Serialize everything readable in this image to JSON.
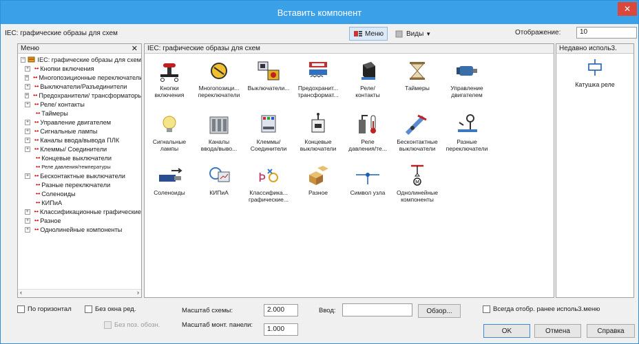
{
  "window": {
    "title": "Вставить компонент",
    "close": "✕"
  },
  "toolbar": {
    "library_label": "IEC: графические образы для схем",
    "menu_button": "Меню",
    "views_button": "Виды",
    "display_label": "Отображение:",
    "display_value": "10"
  },
  "menu_panel": {
    "title": "Меню",
    "close": "✕",
    "root": "IEC: графические образы для схем",
    "items": [
      {
        "label": "Кнопки включения",
        "expandable": true
      },
      {
        "label": "Многопозиционные переключатели",
        "expandable": true
      },
      {
        "label": "Выключатели/Разъединители",
        "expandable": true
      },
      {
        "label": "Предохранители/ трансформаторы",
        "expandable": true
      },
      {
        "label": "Реле/ контакты",
        "expandable": true
      },
      {
        "label": "Таймеры",
        "expandable": false
      },
      {
        "label": "Управление двигателем",
        "expandable": true
      },
      {
        "label": "Сигнальные лампы",
        "expandable": true
      },
      {
        "label": "Каналы ввода/вывода ПЛК",
        "expandable": true
      },
      {
        "label": "Клеммы/ Соединители",
        "expandable": true
      },
      {
        "label": "Концевые выключатели",
        "expandable": false
      },
      {
        "label": "Реле давления/температуры",
        "expandable": false,
        "small": true
      },
      {
        "label": "Бесконтактные выключатели",
        "expandable": true
      },
      {
        "label": "Разные переключатели",
        "expandable": false
      },
      {
        "label": "Соленоиды",
        "expandable": false
      },
      {
        "label": "КИПиА",
        "expandable": false
      },
      {
        "label": "Классификационные графические",
        "expandable": true
      },
      {
        "label": "Разное",
        "expandable": true
      },
      {
        "label": "Однолинейные компоненты",
        "expandable": true
      }
    ]
  },
  "main_panel": {
    "title": "IEC: графические образы для схем",
    "components": [
      {
        "line1": "Кнопки",
        "line2": "включения",
        "icon": "pushbutton-icon"
      },
      {
        "line1": "Многопозици...",
        "line2": "переключатели",
        "icon": "multiposition-switch-icon"
      },
      {
        "line1": "Выключатели...",
        "line2": "",
        "icon": "disconnect-switch-icon"
      },
      {
        "line1": "Предохранит...",
        "line2": "трансформат...",
        "icon": "fuse-transformer-icon"
      },
      {
        "line1": "Реле/",
        "line2": "контакты",
        "icon": "relay-icon"
      },
      {
        "line1": "Таймеры",
        "line2": "",
        "icon": "hourglass-icon"
      },
      {
        "line1": "Управление",
        "line2": "двигателем",
        "icon": "motor-icon"
      },
      {
        "line1": "Сигнальные",
        "line2": "лампы",
        "icon": "lamp-icon"
      },
      {
        "line1": "Каналы",
        "line2": "ввода/выво...",
        "icon": "plc-io-icon"
      },
      {
        "line1": "Клеммы/",
        "line2": "Соединители",
        "icon": "terminal-icon"
      },
      {
        "line1": "Концевые",
        "line2": "выключатели",
        "icon": "limit-switch-icon"
      },
      {
        "line1": "Реле",
        "line2": "давления/те...",
        "icon": "pressure-temp-icon"
      },
      {
        "line1": "Бесконтактные",
        "line2": "выключатели",
        "icon": "proximity-switch-icon"
      },
      {
        "line1": "Разные",
        "line2": "переключатели",
        "icon": "misc-switch-icon"
      },
      {
        "line1": "Соленоиды",
        "line2": "",
        "icon": "solenoid-icon"
      },
      {
        "line1": "КИПиА",
        "line2": "",
        "icon": "instrumentation-icon"
      },
      {
        "line1": "Классифика...",
        "line2": "графические...",
        "icon": "classification-icon"
      },
      {
        "line1": "Разное",
        "line2": "",
        "icon": "boxes-icon"
      },
      {
        "line1": "Символ узла",
        "line2": "",
        "icon": "node-symbol-icon"
      },
      {
        "line1": "Однолинейные",
        "line2": "компоненты",
        "icon": "one-line-icon"
      }
    ]
  },
  "recent_panel": {
    "title": "Недавно исполь3.",
    "items": [
      {
        "label": "Катушка реле",
        "icon": "relay-coil-icon"
      }
    ]
  },
  "bottom": {
    "horizontal_label": "По горизонтал",
    "no_edit_window_label": "Без окна ред.",
    "no_pos_label": "Без поз. обозн.",
    "scheme_scale_label": "Масштаб схемы:",
    "scheme_scale_value": "2.000",
    "panel_scale_label": "Масштаб монт. панели:",
    "panel_scale_value": "1.000",
    "input_label": "Ввод:",
    "input_value": "",
    "browse_button": "Обзор...",
    "always_show_label": "Всегда отобр. ранее исполь3.меню",
    "ok_button": "OK",
    "cancel_button": "Отмена",
    "help_button": "Справка"
  },
  "colors": {
    "title_bar": "#3aa0e8",
    "close": "#d9483b",
    "accent_red": "#c00000"
  }
}
